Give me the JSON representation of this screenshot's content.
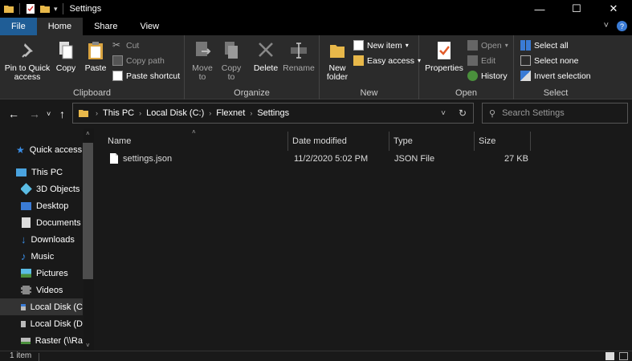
{
  "window": {
    "title": "Settings"
  },
  "tabs": {
    "file": "File",
    "home": "Home",
    "share": "Share",
    "view": "View"
  },
  "ribbon": {
    "clipboard": {
      "label": "Clipboard",
      "pin": "Pin to Quick\naccess",
      "copy": "Copy",
      "paste": "Paste",
      "cut": "Cut",
      "copy_path": "Copy path",
      "paste_shortcut": "Paste shortcut"
    },
    "organize": {
      "label": "Organize",
      "move_to": "Move\nto",
      "copy_to": "Copy\nto",
      "delete": "Delete",
      "rename": "Rename"
    },
    "new": {
      "label": "New",
      "new_folder": "New\nfolder",
      "new_item": "New item",
      "easy_access": "Easy access"
    },
    "open": {
      "label": "Open",
      "properties": "Properties",
      "open": "Open",
      "edit": "Edit",
      "history": "History"
    },
    "select": {
      "label": "Select",
      "select_all": "Select all",
      "select_none": "Select none",
      "invert_selection": "Invert selection"
    }
  },
  "address": {
    "crumbs": [
      "This PC",
      "Local Disk (C:)",
      "Flexnet",
      "Settings"
    ],
    "search_placeholder": "Search Settings"
  },
  "sidebar": {
    "items": [
      {
        "label": "Quick access",
        "icon": "star-icon"
      },
      {
        "label": "This PC",
        "icon": "pc-icon"
      },
      {
        "label": "3D Objects",
        "icon": "cube-icon"
      },
      {
        "label": "Desktop",
        "icon": "desktop-icon"
      },
      {
        "label": "Documents",
        "icon": "documents-icon"
      },
      {
        "label": "Downloads",
        "icon": "download-icon"
      },
      {
        "label": "Music",
        "icon": "music-icon"
      },
      {
        "label": "Pictures",
        "icon": "pictures-icon"
      },
      {
        "label": "Videos",
        "icon": "videos-icon"
      },
      {
        "label": "Local Disk (C",
        "icon": "drive-icon"
      },
      {
        "label": "Local Disk (D",
        "icon": "drive-icon"
      },
      {
        "label": "Raster (\\\\Ra",
        "icon": "network-drive-icon"
      }
    ]
  },
  "files": {
    "columns": {
      "name": "Name",
      "date": "Date modified",
      "type": "Type",
      "size": "Size"
    },
    "rows": [
      {
        "name": "settings.json",
        "date": "11/2/2020 5:02 PM",
        "type": "JSON File",
        "size": "27 KB"
      }
    ]
  },
  "status": {
    "count": "1 item"
  },
  "colors": {
    "accent": "#1f5d96",
    "background": "#191919",
    "ribbon": "#2b2b2b",
    "folder": "#e8b84a"
  }
}
